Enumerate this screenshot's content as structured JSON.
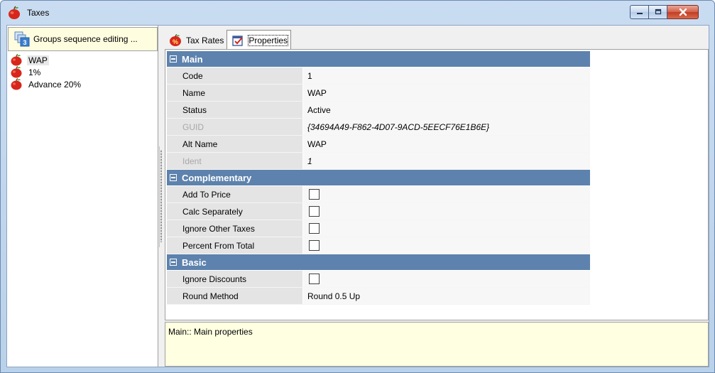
{
  "window": {
    "title": "Taxes",
    "icon": "apple-icon",
    "controls": [
      "minimize-icon",
      "maximize-icon",
      "close-icon"
    ]
  },
  "left_panel": {
    "group_button": {
      "label": "Groups sequence editing ...",
      "icon": "groups-sequence-icon"
    },
    "items": [
      {
        "label": "WAP",
        "icon": "apple-icon",
        "selected": true
      },
      {
        "label": "1%",
        "icon": "apple-icon",
        "selected": false
      },
      {
        "label": "Advance 20%",
        "icon": "apple-icon",
        "selected": false
      }
    ]
  },
  "tabs": [
    {
      "label": "Tax Rates",
      "icon": "percent-apple-icon",
      "active": false
    },
    {
      "label": "Properties",
      "icon": "properties-icon",
      "active": true
    }
  ],
  "property_grid": {
    "categories": [
      {
        "title": "Main",
        "rows": [
          {
            "name": "Code",
            "value": "1",
            "type": "text",
            "disabled": false
          },
          {
            "name": "Name",
            "value": "WAP",
            "type": "text",
            "disabled": false
          },
          {
            "name": "Status",
            "value": "Active",
            "type": "text",
            "disabled": false
          },
          {
            "name": "GUID",
            "value": "{34694A49-F862-4D07-9ACD-5EECF76E1B6E}",
            "type": "text",
            "disabled": true
          },
          {
            "name": "Alt Name",
            "value": "WAP",
            "type": "text",
            "disabled": false
          },
          {
            "name": "Ident",
            "value": "1",
            "type": "text",
            "disabled": true
          }
        ]
      },
      {
        "title": "Complementary",
        "rows": [
          {
            "name": "Add To Price",
            "checked": false,
            "type": "checkbox",
            "disabled": false
          },
          {
            "name": "Calc Separately",
            "checked": false,
            "type": "checkbox",
            "disabled": false
          },
          {
            "name": "Ignore Other Taxes",
            "checked": false,
            "type": "checkbox",
            "disabled": false
          },
          {
            "name": "Percent From Total",
            "checked": false,
            "type": "checkbox",
            "disabled": false
          }
        ]
      },
      {
        "title": "Basic",
        "rows": [
          {
            "name": "Ignore Discounts",
            "checked": false,
            "type": "checkbox",
            "disabled": false
          },
          {
            "name": "Round Method",
            "value": "Round 0.5 Up",
            "type": "text",
            "disabled": false
          }
        ]
      }
    ]
  },
  "description": {
    "text": "Main:: Main properties"
  },
  "colors": {
    "category_header": "#5d82ad",
    "description_bg": "#ffffe1",
    "group_button_bg": "#fffde0"
  }
}
